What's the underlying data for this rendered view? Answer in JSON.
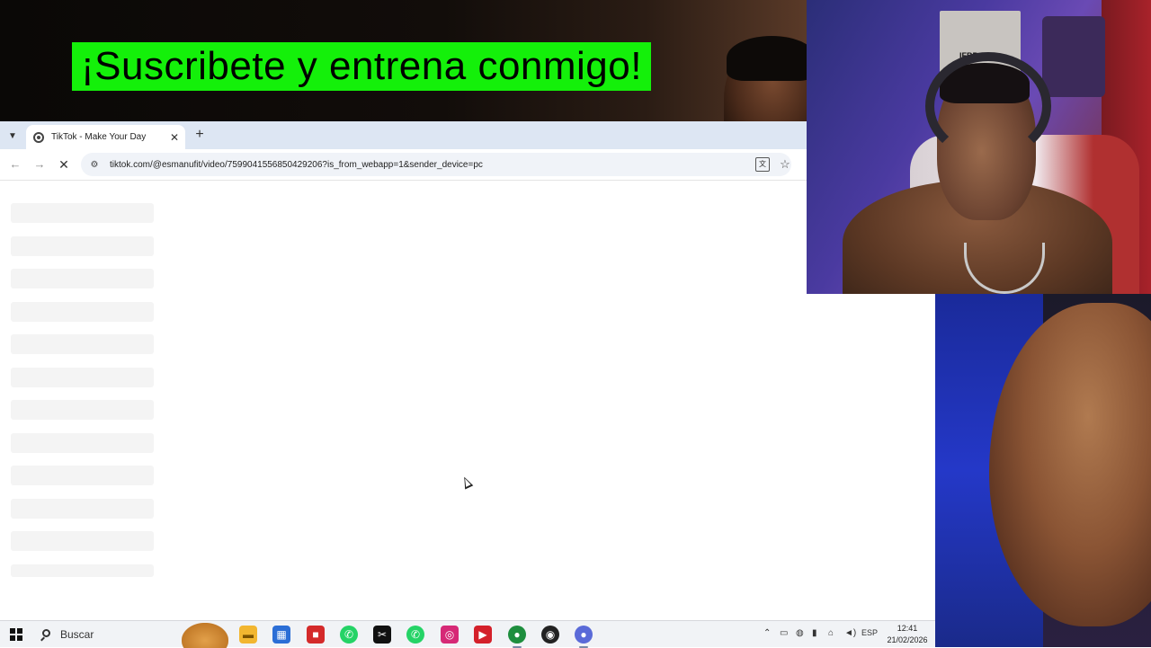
{
  "overlay": {
    "banner_text": "¡Suscribete y entrena conmigo!",
    "banner_color": "#14f00a"
  },
  "browser": {
    "tab_list_icon": "chevron-down-icon",
    "tabs": [
      {
        "title": "TikTok - Make Your Day",
        "favicon": "tiktok-loading-icon",
        "active": true
      }
    ],
    "new_tab_icon": "plus-icon",
    "toolbar": {
      "back_icon": "arrow-left-icon",
      "forward_icon": "arrow-right-icon",
      "reload_state": "stop-loading-icon",
      "site_info_icon": "tune-icon",
      "url": "tiktok.com/@esmanufit/video/7599041556850429206?is_from_webapp=1&sender_device=pc",
      "translate_icon": "translate-icon",
      "bookmark_icon": "star-icon"
    },
    "page_state": "loading",
    "skeleton_rows": 12
  },
  "webcam": {
    "poster_text": "IFBB"
  },
  "taskbar": {
    "search_placeholder": "Buscar",
    "apps": [
      {
        "name": "file-explorer",
        "icon": "folder-icon",
        "color": "#f2b630"
      },
      {
        "name": "microsoft-store",
        "icon": "store-icon",
        "color": "#2b6ed6"
      },
      {
        "name": "red-app",
        "icon": "app-icon",
        "color": "#d42a2a"
      },
      {
        "name": "whatsapp-1",
        "icon": "whatsapp-icon",
        "color": "#25d366"
      },
      {
        "name": "capcut",
        "icon": "capcut-icon",
        "color": "#111111"
      },
      {
        "name": "whatsapp-2",
        "icon": "whatsapp-icon",
        "color": "#25d366"
      },
      {
        "name": "instagram",
        "icon": "instagram-icon",
        "color": "#d62976"
      },
      {
        "name": "streaming-app",
        "icon": "stream-icon",
        "color": "#d4202a"
      },
      {
        "name": "chrome",
        "icon": "chrome-icon",
        "color": "#1e8e3e"
      },
      {
        "name": "obs",
        "icon": "record-icon",
        "color": "#222222"
      },
      {
        "name": "chrome-profile",
        "icon": "chrome-icon",
        "color": "#5a6ad8"
      }
    ],
    "tray": {
      "overflow_icon": "chevron-up-icon",
      "language": "ESP",
      "time": "12:41",
      "date": "21/02/2026"
    }
  }
}
